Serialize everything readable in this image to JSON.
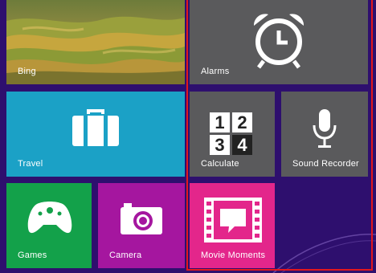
{
  "tiles": {
    "bing": {
      "label": "Bing"
    },
    "travel": {
      "label": "Travel",
      "icon": "briefcase-icon"
    },
    "games": {
      "label": "Games",
      "icon": "xbox-controller-icon"
    },
    "camera": {
      "label": "Camera",
      "icon": "camera-icon"
    },
    "alarms": {
      "label": "Alarms",
      "icon": "alarm-clock-icon"
    },
    "calculator": {
      "label": "Calculate",
      "icon": "calculator-icon",
      "digits": [
        "1",
        "2",
        "3",
        "4"
      ]
    },
    "sound_recorder": {
      "label": "Sound Recorder",
      "icon": "microphone-icon"
    },
    "movie_moments": {
      "label": "Movie Moments",
      "icon": "film-speech-bubble-icon"
    }
  },
  "colors": {
    "background": "#2e0f6e",
    "travel": "#1ba1c6",
    "games": "#13a14a",
    "camera": "#a5169f",
    "gray_tile": "#5a5a5c",
    "movie_moments": "#e3268b",
    "highlight": "#e3171d"
  }
}
